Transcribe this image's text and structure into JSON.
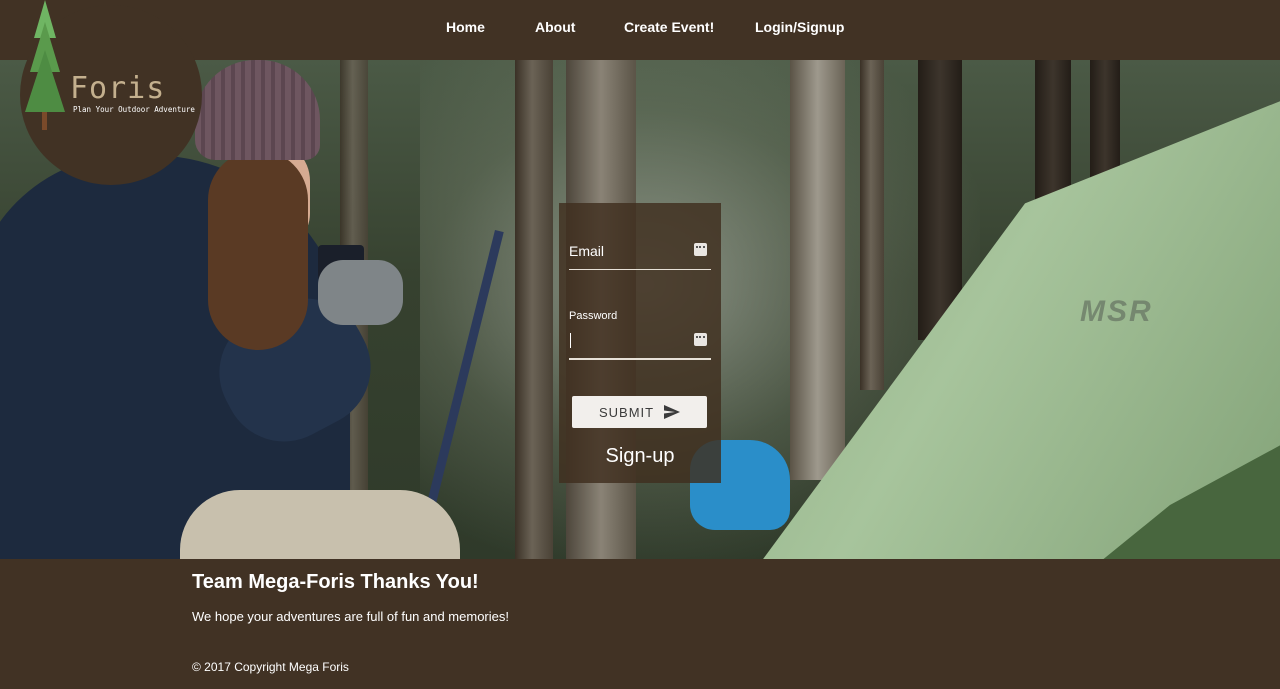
{
  "nav": {
    "items": [
      {
        "label": "Home"
      },
      {
        "label": "About"
      },
      {
        "label": "Create Event!"
      },
      {
        "label": "Login/Signup"
      }
    ]
  },
  "logo": {
    "title": "Foris",
    "tagline": "Plan Your Outdoor Adventure",
    "icon": "pine-tree-icon"
  },
  "hero": {
    "tent_brand_text": "MSR"
  },
  "login": {
    "email_label": "Email",
    "email_value": "",
    "password_label": "Password",
    "password_value": "",
    "field_icon": "password-manager-key-icon",
    "submit_label": "SUBMIT",
    "submit_icon": "send-icon",
    "signup_label": "Sign-up"
  },
  "footer": {
    "title": "Team Mega-Foris Thanks You!",
    "message": "We hope your adventures are full of fun and memories!",
    "copyright": "© 2017 Copyright Mega Foris"
  },
  "colors": {
    "brand_brown": "#413224",
    "logo_text": "#c4b08e",
    "logo_tree": "#5a9a4c"
  }
}
